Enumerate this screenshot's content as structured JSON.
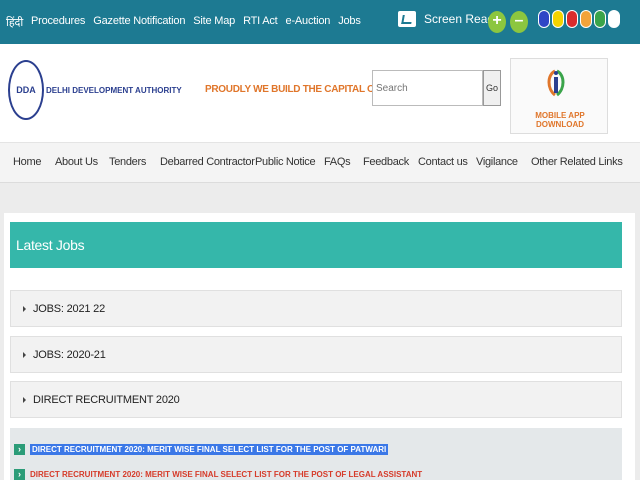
{
  "topbar": {
    "links": [
      "हिंदी",
      "Procedures",
      "Gazette Notification",
      "Site Map",
      "RTI Act",
      "e-Auction",
      "Jobs"
    ],
    "screen_reader_label": "Screen Reader",
    "zoom_in": "+",
    "zoom_out": "–",
    "theme_colors": [
      "#2f46c6",
      "#f4d400",
      "#d92c2c",
      "#f3a33a",
      "#3aa44a",
      "#ffffff"
    ]
  },
  "header": {
    "logo_mark": "DDA",
    "org_name": "DELHI DEVELOPMENT AUTHORITY",
    "tagline": "PROUDLY WE BUILD THE CAPITAL OF INDIA",
    "search_placeholder": "Search",
    "search_button": "Go",
    "app_label": "MOBILE APP DOWNLOAD",
    "accent": "#e0762b"
  },
  "nav": {
    "items": [
      "Home",
      "About Us",
      "Tenders",
      "Debarred Contractor",
      "Public Notice",
      "FAQs",
      "Feedback",
      "Contact us",
      "Vigilance",
      "Other Related Links"
    ]
  },
  "main": {
    "panel_title": "Latest Jobs",
    "accordion": [
      "JOBS: 2021 22",
      "JOBS: 2020-21",
      "DIRECT RECRUITMENT 2020"
    ],
    "listing": [
      "DIRECT RECRUITMENT 2020: MERIT WISE FINAL SELECT LIST FOR THE POST OF PATWARI",
      "DIRECT RECRUITMENT 2020: MERIT WISE FINAL SELECT LIST FOR THE POST OF LEGAL ASSISTANT"
    ]
  }
}
